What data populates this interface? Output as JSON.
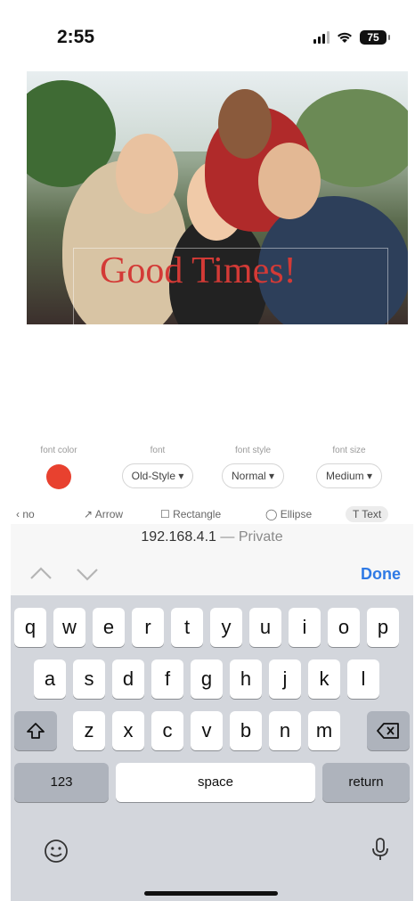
{
  "status_bar": {
    "time": "2:55",
    "battery": "75"
  },
  "photo": {
    "icon": "photo-image",
    "overlay_text": "Good Times!",
    "overlay_color": "#d33a36"
  },
  "font_toolbar": {
    "font_color": {
      "label": "font color",
      "value": "#e8412f"
    },
    "font": {
      "label": "font",
      "value": "Old-Style ▾"
    },
    "font_style": {
      "label": "font style",
      "value": "Normal ▾"
    },
    "font_size": {
      "label": "font size",
      "value": "Medium ▾"
    }
  },
  "tools": {
    "items": [
      {
        "label": "‹ no",
        "icon": "chevron-left"
      },
      {
        "label": "↗ Arrow",
        "icon": "arrow-icon"
      },
      {
        "label": "☐ Rectangle",
        "icon": "rectangle-icon"
      },
      {
        "label": "◯ Ellipse",
        "icon": "ellipse-icon"
      },
      {
        "label": "T Text",
        "icon": "text-icon",
        "active": true
      }
    ]
  },
  "address_bar": {
    "host": "192.168.4.1",
    "separator": " — ",
    "mode": "Private"
  },
  "accessory_bar": {
    "done_label": "Done",
    "accent_color": "#2f7ae5"
  },
  "keyboard": {
    "row1": [
      "q",
      "w",
      "e",
      "r",
      "t",
      "y",
      "u",
      "i",
      "o",
      "p"
    ],
    "row2": [
      "a",
      "s",
      "d",
      "f",
      "g",
      "h",
      "j",
      "k",
      "l"
    ],
    "row3": [
      "z",
      "x",
      "c",
      "v",
      "b",
      "n",
      "m"
    ],
    "numbers_label": "123",
    "space_label": "space",
    "return_label": "return",
    "shift_icon": "shift-icon",
    "delete_icon": "delete-icon",
    "emoji_icon": "emoji-icon",
    "mic_icon": "microphone-icon"
  }
}
